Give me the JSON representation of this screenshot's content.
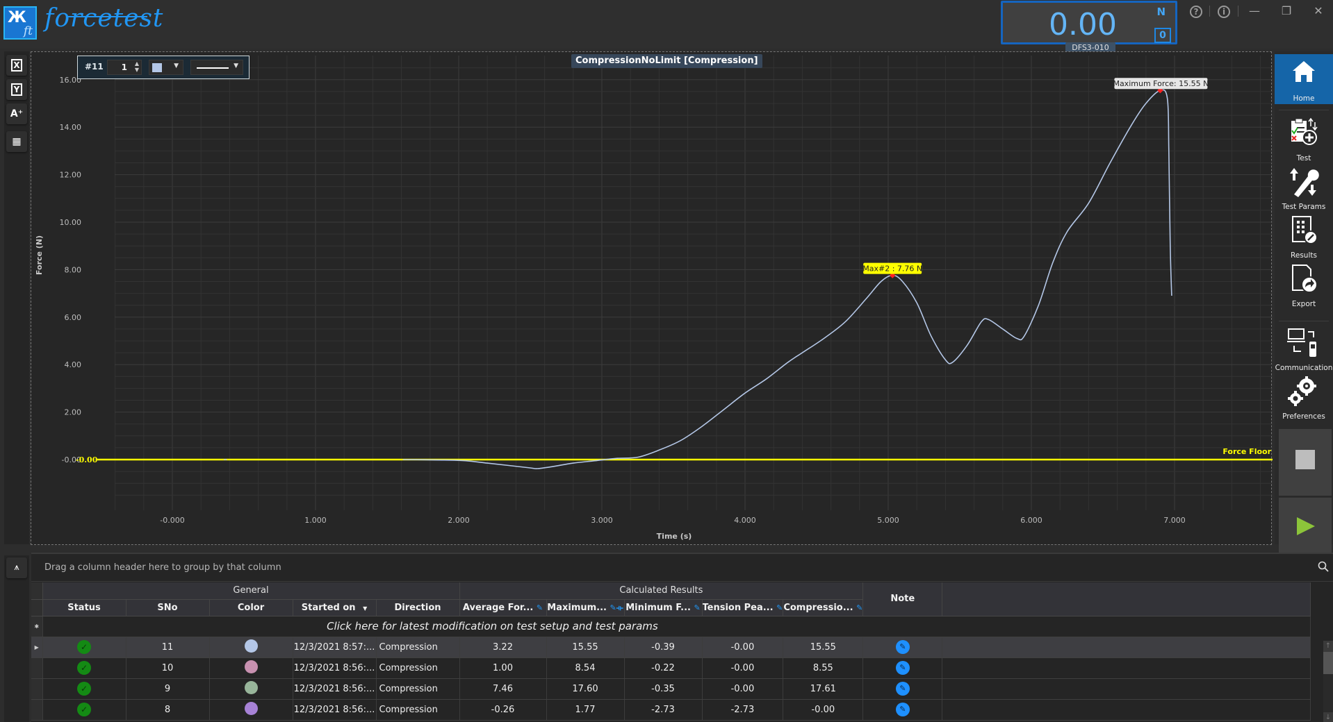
{
  "app": {
    "logo_mark": "Ж",
    "logo_sub": "ft",
    "name": "forcetest"
  },
  "readout": {
    "value": "0.00",
    "unit": "N",
    "zero_label": "0",
    "device": "DFS3-010"
  },
  "window_controls": {
    "help": "?",
    "info": "i",
    "minimize": "—",
    "restore": "❐",
    "close": "✕"
  },
  "left_tools": [
    {
      "name": "x-axis",
      "label": "X"
    },
    {
      "name": "y-axis",
      "label": "Y"
    },
    {
      "name": "add-annotation",
      "label": "A⁺"
    },
    {
      "name": "table",
      "label": "▦"
    }
  ],
  "series_toolbar": {
    "series_id": "#11",
    "line_width": "1",
    "color": "#b4c7e7"
  },
  "chart_data": {
    "type": "line",
    "title": "CompressionNoLimit [Compression]",
    "xlabel": "Time (s)",
    "ylabel": "Force (N)",
    "xlim": [
      -0.68,
      7.68
    ],
    "ylim": [
      -1.5,
      16.8
    ],
    "x_ticks": [
      0,
      1,
      2,
      3,
      4,
      5,
      6,
      7
    ],
    "x_tick_labels": [
      "-0.000",
      "1.000",
      "2.000",
      "3.000",
      "4.000",
      "5.000",
      "6.000",
      "7.000"
    ],
    "y_ticks": [
      0,
      2,
      4,
      6,
      8,
      10,
      12,
      14,
      16
    ],
    "y_tick_labels": [
      "-0.00",
      "2.00",
      "4.00",
      "6.00",
      "8.00",
      "10.00",
      "12.00",
      "14.00",
      "16.00"
    ],
    "grid": true,
    "series": [
      {
        "name": "#11",
        "color": "#b4c7e7",
        "x": [
          0.36,
          0.38,
          1.61,
          1.9,
          2.05,
          2.2,
          2.35,
          2.5,
          2.55,
          2.65,
          2.8,
          2.95,
          3.1,
          3.25,
          3.4,
          3.55,
          3.7,
          3.85,
          4.0,
          4.15,
          4.3,
          4.4,
          4.55,
          4.7,
          4.85,
          4.95,
          5.03,
          5.1,
          5.2,
          5.3,
          5.4,
          5.45,
          5.55,
          5.65,
          5.7,
          5.8,
          5.9,
          5.95,
          6.05,
          6.15,
          6.25,
          6.4,
          6.55,
          6.7,
          6.8,
          6.9,
          6.95,
          6.96,
          6.97,
          6.98
        ],
        "y": [
          0.0,
          0.0,
          0.0,
          -0.02,
          -0.05,
          -0.15,
          -0.25,
          -0.35,
          -0.38,
          -0.3,
          -0.15,
          -0.05,
          0.05,
          0.1,
          0.4,
          0.8,
          1.4,
          2.1,
          2.8,
          3.4,
          4.1,
          4.5,
          5.1,
          5.8,
          6.8,
          7.5,
          7.76,
          7.5,
          6.6,
          5.2,
          4.2,
          4.1,
          4.8,
          5.8,
          5.9,
          5.5,
          5.1,
          5.2,
          6.5,
          8.3,
          9.6,
          10.8,
          12.5,
          14.1,
          15.0,
          15.55,
          15.2,
          13.0,
          9.0,
          6.9
        ]
      }
    ],
    "annotations": [
      {
        "label": "Maximum Force: 15.55 N",
        "x": 6.9,
        "y": 15.55,
        "style": "light"
      },
      {
        "label": "Max#2 : 7.76 N",
        "x": 5.03,
        "y": 7.76,
        "style": "yellow"
      }
    ],
    "reference_lines": [
      {
        "label": "Force Floor",
        "value_label": "-0.00",
        "y": 0.0,
        "color": "#ffff00"
      }
    ]
  },
  "right_nav": [
    {
      "name": "home",
      "label": "Home",
      "active": true
    },
    {
      "name": "test",
      "label": "Test"
    },
    {
      "name": "test-params",
      "label": "Test Params"
    },
    {
      "name": "results",
      "label": "Results"
    },
    {
      "name": "export",
      "label": "Export"
    },
    {
      "name": "communication",
      "label": "Communication"
    },
    {
      "name": "preferences",
      "label": "Preferences"
    }
  ],
  "grid": {
    "group_hint": "Drag a column header here to group by that column",
    "groups": [
      "General",
      "Calculated Results",
      "Note"
    ],
    "columns": [
      "Status",
      "SNo",
      "Color",
      "Started on",
      "Direction",
      "Average For...",
      "Maximum...",
      "Minimum F...",
      "Tension Pea...",
      "Compressio..."
    ],
    "new_row_text": "Click here for latest modification on test setup and test params",
    "rows": [
      {
        "status": "ok",
        "sno": "11",
        "color": "#b4c7e7",
        "started": "12/3/2021 8:57:...",
        "direction": "Compression",
        "avg": "3.22",
        "max": "15.55",
        "min": "-0.39",
        "tension": "-0.00",
        "compression": "15.55",
        "selected": true
      },
      {
        "status": "ok",
        "sno": "10",
        "color": "#c891b0",
        "started": "12/3/2021 8:56:...",
        "direction": "Compression",
        "avg": "1.00",
        "max": "8.54",
        "min": "-0.22",
        "tension": "-0.00",
        "compression": "8.55"
      },
      {
        "status": "ok",
        "sno": "9",
        "color": "#98b59a",
        "started": "12/3/2021 8:56:...",
        "direction": "Compression",
        "avg": "7.46",
        "max": "17.60",
        "min": "-0.35",
        "tension": "-0.00",
        "compression": "17.61"
      },
      {
        "status": "ok",
        "sno": "8",
        "color": "#a782d6",
        "started": "12/3/2021 8:56:...",
        "direction": "Compression",
        "avg": "-0.26",
        "max": "1.77",
        "min": "-2.73",
        "tension": "-2.73",
        "compression": "-0.00"
      }
    ]
  }
}
